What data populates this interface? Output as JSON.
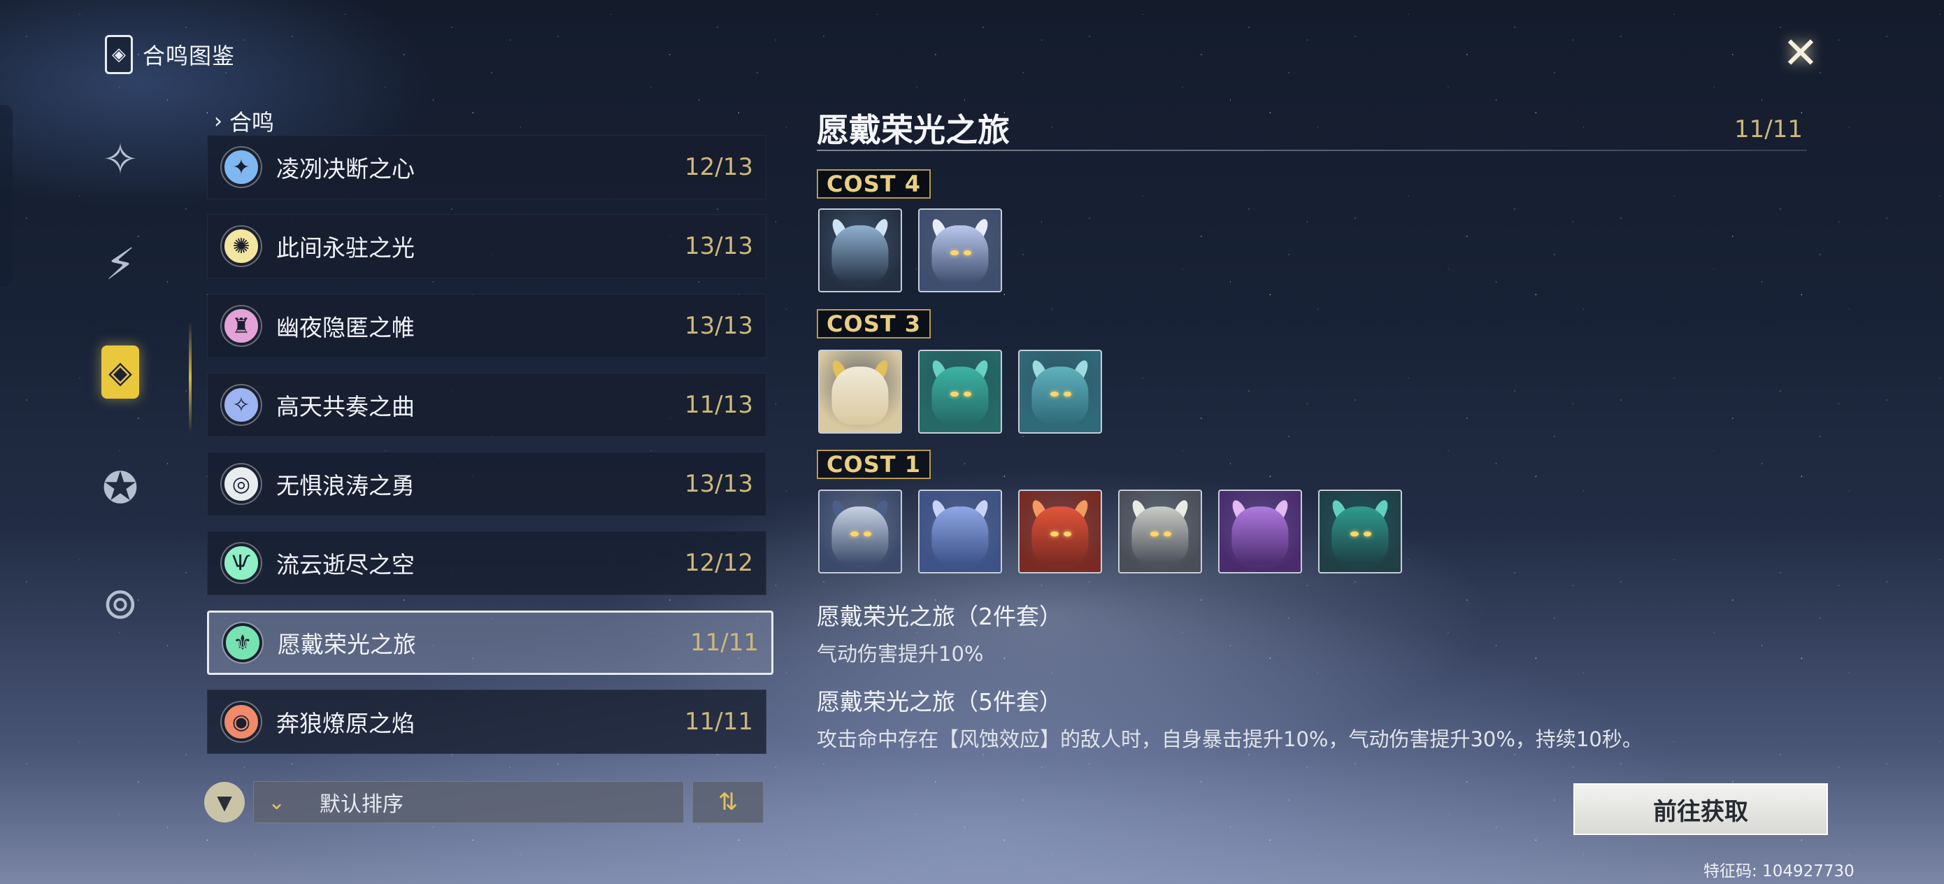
{
  "header": {
    "title": "合鸣图鉴",
    "logo_glyph": "◈"
  },
  "close_glyph": "✕",
  "nav": {
    "items": [
      {
        "name": "nav-item-1",
        "glyph": "✧",
        "icon": "star-compass-icon"
      },
      {
        "name": "nav-item-2",
        "glyph": "⚡",
        "icon": "lightning-stack-icon"
      },
      {
        "name": "nav-item-3",
        "glyph": "◈",
        "icon": "sonata-card-icon",
        "active": true
      },
      {
        "name": "nav-item-4",
        "glyph": "✪",
        "icon": "pentagon-circle-icon"
      },
      {
        "name": "nav-item-5",
        "glyph": "⊚",
        "icon": "eye-ring-icon"
      }
    ]
  },
  "list": {
    "breadcrumb_arrow": "›",
    "breadcrumb": "合鸣",
    "sets": [
      {
        "name": "凌冽决断之心",
        "count": "12/13",
        "glyph": "✦",
        "color": "#7fb7f0"
      },
      {
        "name": "此间永驻之光",
        "count": "13/13",
        "glyph": "✺",
        "color": "#f3e6a0"
      },
      {
        "name": "幽夜隐匿之帷",
        "count": "13/13",
        "glyph": "♜",
        "color": "#e4a3d8"
      },
      {
        "name": "高天共奏之曲",
        "count": "11/13",
        "glyph": "✧",
        "color": "#9db4f2"
      },
      {
        "name": "无惧浪涛之勇",
        "count": "13/13",
        "glyph": "◎",
        "color": "#e9ecef"
      },
      {
        "name": "流云逝尽之空",
        "count": "12/12",
        "glyph": "Ѱ",
        "color": "#8ff0c6"
      },
      {
        "name": "愿戴荣光之旅",
        "count": "11/11",
        "glyph": "⚜",
        "color": "#78e3b2",
        "selected": true
      },
      {
        "name": "奔狼燎原之焰",
        "count": "11/11",
        "glyph": "◉",
        "color": "#f08a6a"
      }
    ],
    "sort_label": "默认排序",
    "sort_chevron": "⌄",
    "order_glyph": "⇅",
    "filter_glyph": "▼"
  },
  "detail": {
    "title": "愿戴荣光之旅",
    "count": "11/11",
    "groups": [
      {
        "label": "COST 4",
        "echoes": [
          {
            "name": "echo-cost4-1",
            "bg": "#243042",
            "head": "#8fb0d0",
            "horn": "#cfe3f6",
            "eye": false
          },
          {
            "name": "echo-cost4-2",
            "bg": "#3e4e6e",
            "head": "#b9c9ee",
            "horn": "#e8ecf6",
            "eye": true
          }
        ]
      },
      {
        "label": "COST 3",
        "echoes": [
          {
            "name": "echo-cost3-1",
            "bg": "#d9c9a0",
            "head": "#f1ead8",
            "horn": "#e2c05a",
            "eye": false
          },
          {
            "name": "echo-cost3-2",
            "bg": "#256a66",
            "head": "#3cb3a5",
            "horn": "#69d1c2",
            "eye": true
          },
          {
            "name": "echo-cost3-3",
            "bg": "#2f6a78",
            "head": "#5fb2bd",
            "horn": "#9edbe0",
            "eye": true
          }
        ]
      },
      {
        "label": "COST 1",
        "echoes": [
          {
            "name": "echo-cost1-1",
            "bg": "#3b4a6a",
            "head": "#c8d2e4",
            "horn": "#4a5f8a",
            "eye": true
          },
          {
            "name": "echo-cost1-2",
            "bg": "#3d5287",
            "head": "#8fa7e6",
            "horn": "#c7d4f6",
            "eye": false
          },
          {
            "name": "echo-cost1-3",
            "bg": "#7a2a22",
            "head": "#e2553a",
            "horn": "#f59a5e",
            "eye": true
          },
          {
            "name": "echo-cost1-4",
            "bg": "#4a4e58",
            "head": "#c9ccc6",
            "horn": "#e9ebe5",
            "eye": true
          },
          {
            "name": "echo-cost1-5",
            "bg": "#4a2c6e",
            "head": "#b07ae0",
            "horn": "#e2b9f3",
            "eye": false
          },
          {
            "name": "echo-cost1-6",
            "bg": "#1f3f45",
            "head": "#2e9c8e",
            "horn": "#62d0bf",
            "eye": true
          }
        ]
      }
    ],
    "bonus2_title": "愿戴荣光之旅（2件套）",
    "bonus2_desc": "气动伤害提升10%",
    "bonus5_title": "愿戴荣光之旅（5件套）",
    "bonus5_desc": "攻击命中存在【风蚀效应】的敌人时，自身暴击提升10%，气动伤害提升30%，持续10秒。"
  },
  "action_button": "前往获取",
  "uid": "特征码: 104927730"
}
